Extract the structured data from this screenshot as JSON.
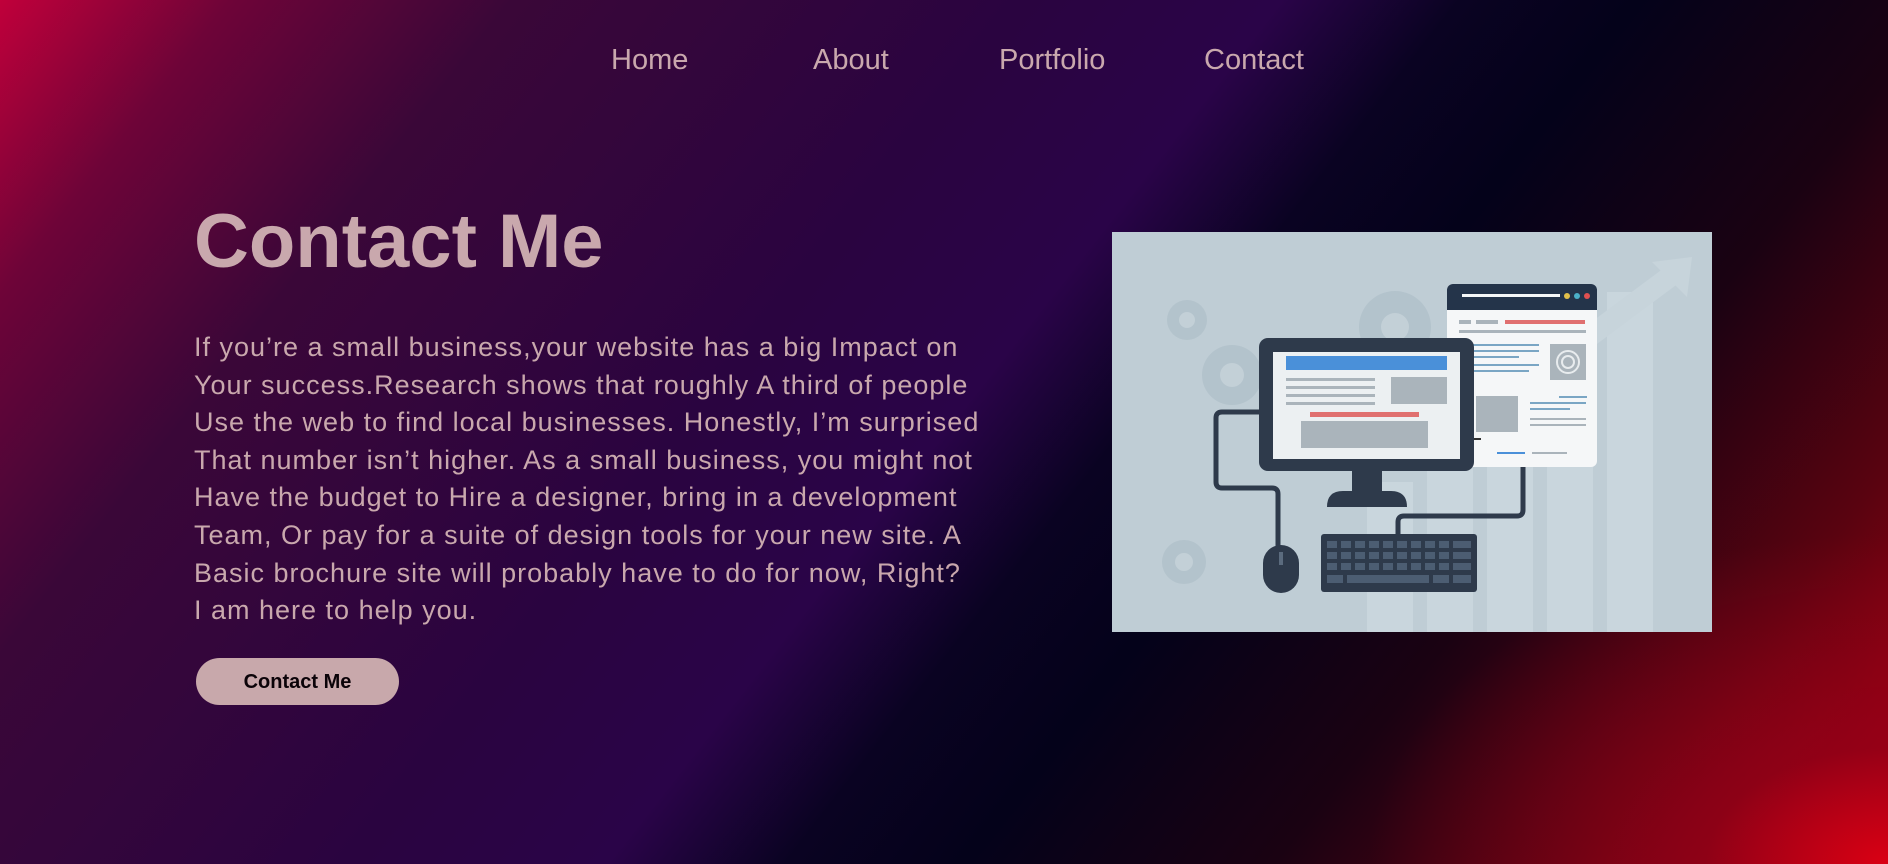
{
  "nav": {
    "items": [
      {
        "label": "Home"
      },
      {
        "label": "About"
      },
      {
        "label": "Portfolio"
      },
      {
        "label": "Contact"
      }
    ]
  },
  "hero": {
    "title": "Contact Me",
    "paragraph_lines": [
      "If you’re a small business,your website has a big Impact on",
      "Your success.Research shows that roughly A third of people",
      "Use the web to find local businesses. Honestly, I’m surprised",
      "That number isn’t higher. As a small business, you might not",
      "Have the budget to Hire a designer, bring in a development",
      "Team, Or pay for a suite of design tools for your new site. A",
      "Basic brochure site will probably have to do for now, Right?",
      "I am here to help you."
    ],
    "button_label": "Contact Me"
  },
  "illustration": {
    "icon": "computer-setup-illustration"
  },
  "colors": {
    "text": "#c9a8ad",
    "button_bg": "#c8a8ab",
    "illustration_bg": "#bfcdd5",
    "monitor": "#2e3a4b",
    "accent_blue": "#4a90d9",
    "accent_red": "#e07070"
  }
}
